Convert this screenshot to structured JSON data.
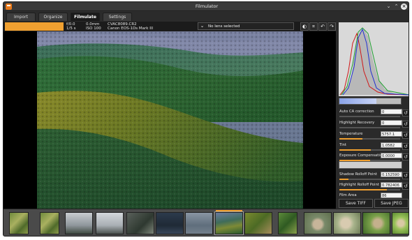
{
  "window": {
    "title": "Filmulator"
  },
  "tabs": [
    {
      "label": "Import"
    },
    {
      "label": "Organize"
    },
    {
      "label": "Filmulate"
    },
    {
      "label": "Settings"
    }
  ],
  "info": {
    "aperture": "f/0.0",
    "shutter": "1/5 s",
    "focal": "0.0mm",
    "iso": "ISO 100",
    "filename": "CVAC8089.CR2",
    "camera": "Canon EOS-1Ds Mark III",
    "lens": "No lens selected",
    "progress": 1.0
  },
  "tools": [
    {
      "icon": "contrast-icon",
      "glyph": "◐"
    },
    {
      "icon": "crop-icon",
      "glyph": "⌗"
    },
    {
      "icon": "rotate-left-icon",
      "glyph": "↶"
    },
    {
      "icon": "rotate-right-icon",
      "glyph": "↷"
    }
  ],
  "params": [
    {
      "id": "auto-ca-correction",
      "name": "Auto CA correction",
      "value": "0",
      "fill": 0.0
    },
    {
      "id": "highlight-recovery",
      "name": "Highlight Recovery",
      "value": "0",
      "fill": 0.0
    },
    {
      "id": "temperature",
      "name": "Temperature",
      "value": "5757.1",
      "fill": 0.38
    },
    {
      "id": "tint",
      "name": "Tint",
      "value": "1.0582",
      "fill": 0.52
    },
    {
      "id": "exposure-compensation",
      "name": "Exposure Compensation",
      "value": "0.0000",
      "fill": 0.5
    },
    {
      "id": "shadow-rolloff-point",
      "name": "Shadow Rolloff Point",
      "value": "0.152590",
      "fill": 0.15
    },
    {
      "id": "highlight-rolloff-point",
      "name": "Highlight Rolloff Point",
      "value": "0.782406",
      "fill": 0.78
    },
    {
      "id": "film-area",
      "name": "Film Area",
      "value": "86",
      "fill": 0.4
    }
  ],
  "buttons": {
    "save_tiff": "Save TIFF",
    "save_jpeg": "Save JPEG"
  },
  "colors": {
    "accent": "#f0a030",
    "background": "#2f2f2f",
    "panel": "#2a2a2a"
  },
  "filmstrip": [
    {
      "kind": "moss",
      "marked": false
    },
    {
      "kind": "moss",
      "marked": false
    },
    {
      "kind": "tree",
      "marked": false
    },
    {
      "kind": "grey-sky",
      "marked": false
    },
    {
      "kind": "tree-dark",
      "marked": false
    },
    {
      "kind": "dark-blue",
      "marked": false
    },
    {
      "kind": "slate",
      "marked": false
    },
    {
      "kind": "hills",
      "marked": true
    },
    {
      "kind": "moss-brown",
      "marked": false
    },
    {
      "kind": "fern",
      "marked": false
    },
    {
      "kind": "bird",
      "marked": false
    },
    {
      "kind": "bird-light",
      "marked": false
    },
    {
      "kind": "bird-green",
      "marked": false
    },
    {
      "kind": "bird-bright",
      "marked": false
    }
  ]
}
